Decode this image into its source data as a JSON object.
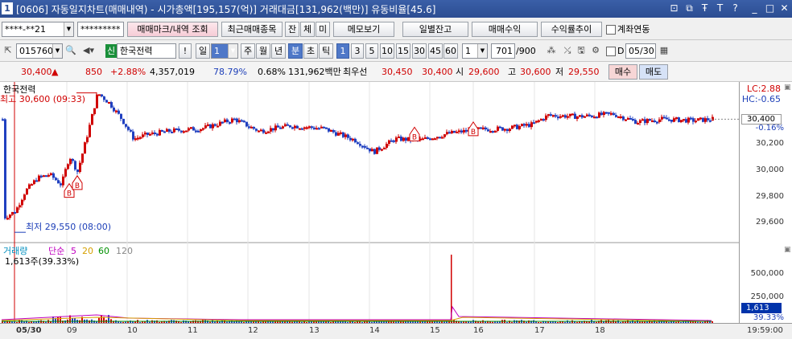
{
  "window": {
    "title": "[0606] 자동일지차트(매매내역) - 시가총액[195,157(억)] 거래대금[131,962(백만)] 유동비율[45.6]",
    "app_icon": "1",
    "buttons": [
      "⊡",
      "⧉",
      "Ŧ",
      "T",
      "?",
      "_",
      "□",
      "✕"
    ]
  },
  "toolbar1": {
    "account": "****-**21",
    "password": "*********",
    "trade_mark_btn": "매매마크/내역 조회",
    "recent_btn": "최근매매종목",
    "jan": "잔",
    "che": "체",
    "mi": "미",
    "memo_btn": "메모보기",
    "daily_balance_btn": "일별잔고",
    "trade_profit_btn": "매매수익",
    "profit_trend_btn": "수익률추이",
    "account_link_label": "계좌연동"
  },
  "toolbar2": {
    "code": "015760",
    "badge": "신",
    "stock_name": "한국전력",
    "warn": "!",
    "period_day": "일",
    "period_val": "1",
    "week": "주",
    "month": "월",
    "year": "년",
    "minute": "분",
    "second": "초",
    "tick": "틱",
    "intervals": [
      "1",
      "3",
      "5",
      "10",
      "15",
      "30",
      "45",
      "60"
    ],
    "interval_custom": "1",
    "count": "701",
    "count_max": "/900",
    "d_label": "D",
    "date": "05/30"
  },
  "quote": {
    "price": "30,400",
    "change": "850",
    "change_pct": "+2.88%",
    "volume": "4,357,019",
    "vol_ratio": "78.79%",
    "turnover": "0.68%",
    "amount": "131,962백만",
    "order_label": "최우선",
    "ask": "30,450",
    "bid": "30,400",
    "open_label": "시",
    "open": "29,600",
    "high_label": "고",
    "high": "30,600",
    "low_label": "저",
    "low": "29,550",
    "buy_btn": "매수",
    "sell_btn": "매도"
  },
  "chart": {
    "price_title": "한국전력",
    "high_note": "최고 30,600 (09:33)",
    "low_note": "최저 29,550 (08:00)",
    "lc": "LC:2.88",
    "hc": "HC:-0.65",
    "cur_price_tag": "30,400",
    "cur_pct_tag": "-0.16%",
    "buy_marker": "B",
    "vol_title": "거래량",
    "vol_ma": [
      "단순",
      "5",
      "20",
      "60",
      "120"
    ],
    "vol_ma_colors": [
      "#c000c0",
      "#c000c0",
      "#d6a000",
      "#009000",
      "#888888"
    ],
    "vol_info": "1,613주(39.33%)",
    "vol_tag": "1,613",
    "vol_pct_tag": "39.33%",
    "bottom_time": "19:59:00"
  },
  "chart_data": {
    "type": "candlestick",
    "price_axis_ticks": [
      "30,200",
      "30,000",
      "29,800",
      "29,600"
    ],
    "volume_axis_ticks": [
      "500,000",
      "250,000"
    ],
    "x_labels": [
      "05/30",
      "09",
      "10",
      "11",
      "12",
      "13",
      "14",
      "15",
      "16",
      "17",
      "18"
    ],
    "price_ylim": [
      29500,
      30640
    ],
    "price_high": 30600,
    "price_low": 29550,
    "last_price": 30400,
    "buy_markers": [
      29890,
      29950,
      30320,
      30360
    ]
  }
}
